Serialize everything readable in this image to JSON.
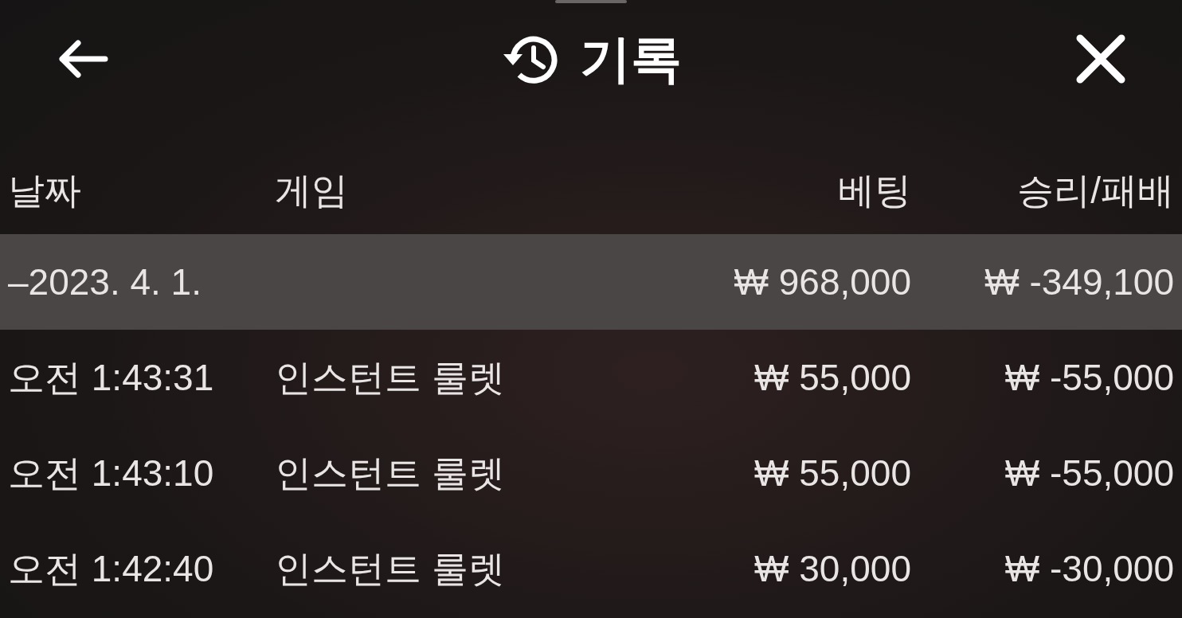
{
  "header": {
    "title": "기록"
  },
  "table": {
    "columns": [
      "날짜",
      "게임",
      "베팅",
      "승리/패배"
    ],
    "groups": [
      {
        "date": "–2023. 4. 1.",
        "bet": "₩ 968,000",
        "result": "₩ -349,100",
        "rows": [
          {
            "time": "오전 1:43:31",
            "game": "인스턴트 룰렛",
            "bet": "₩ 55,000",
            "result": "₩ -55,000"
          },
          {
            "time": "오전 1:43:10",
            "game": "인스턴트 룰렛",
            "bet": "₩ 55,000",
            "result": "₩ -55,000"
          },
          {
            "time": "오전 1:42:40",
            "game": "인스턴트 룰렛",
            "bet": "₩ 30,000",
            "result": "₩ -30,000"
          }
        ]
      }
    ]
  }
}
